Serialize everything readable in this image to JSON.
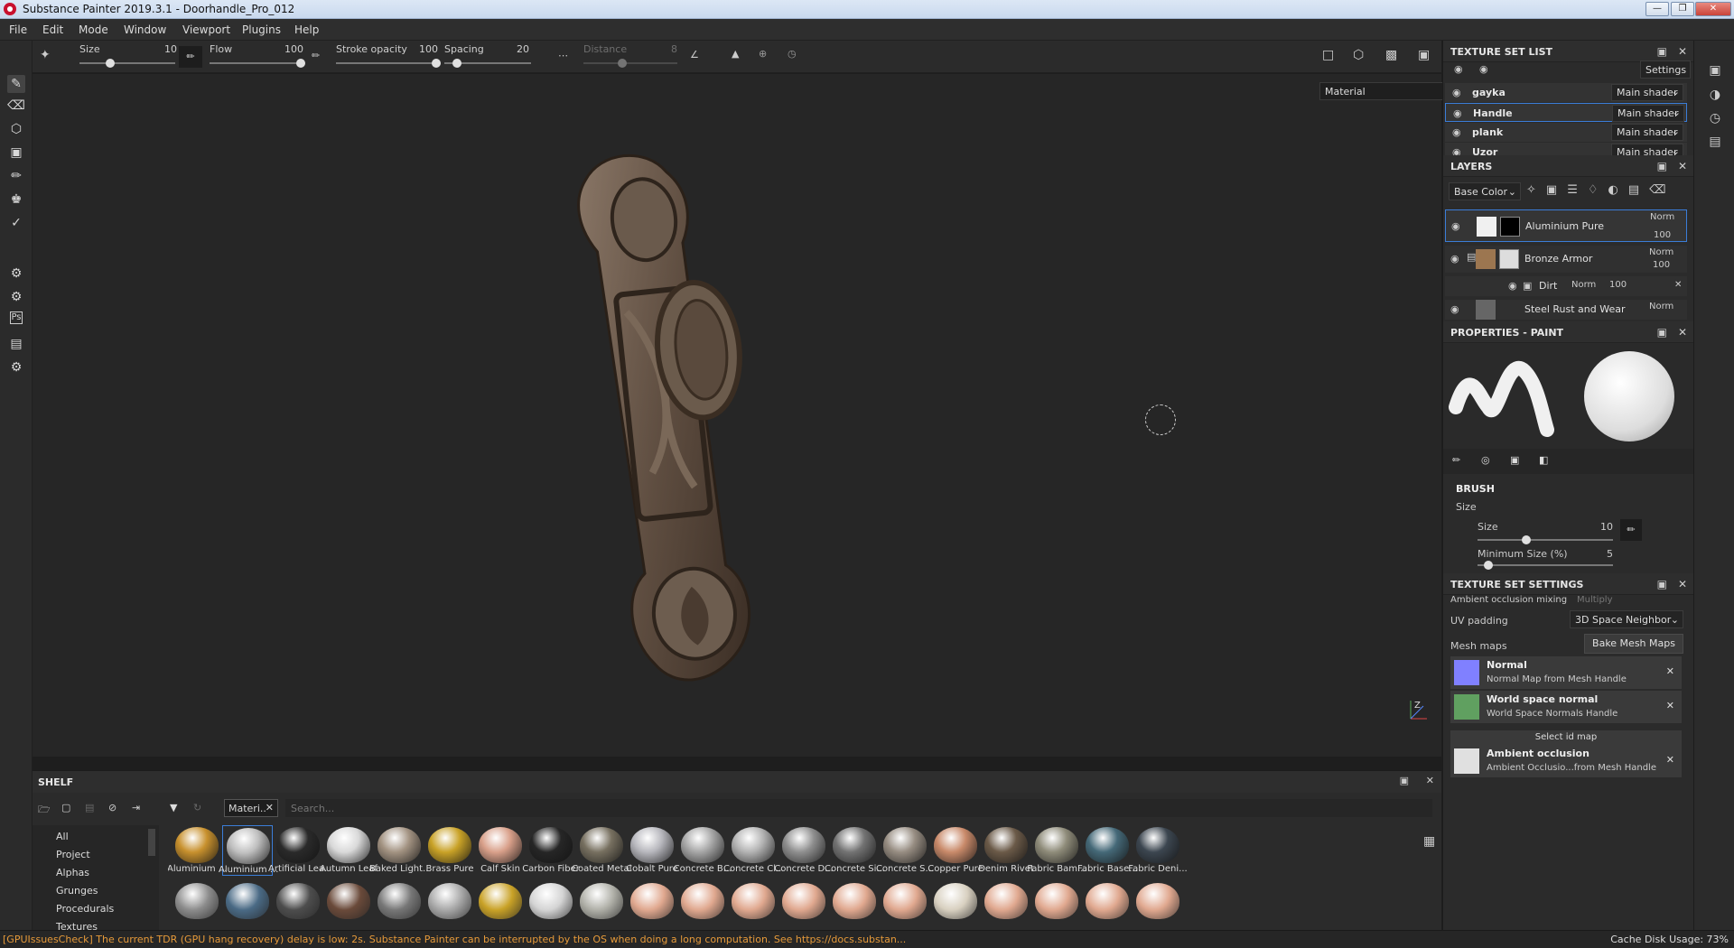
{
  "window": {
    "title": "Substance Painter 2019.3.1 - Doorhandle_Pro_012"
  },
  "menu": [
    "File",
    "Edit",
    "Mode",
    "Window",
    "Viewport",
    "Plugins",
    "Help"
  ],
  "toolbar": {
    "size_label": "Size",
    "size_value": "10",
    "size_level": 0.3,
    "flow_label": "Flow",
    "flow_value": "100",
    "flow_level": 1.0,
    "opacity_label": "Stroke opacity",
    "opacity_value": "100",
    "opacity_level": 1.0,
    "spacing_label": "Spacing",
    "spacing_value": "20",
    "spacing_level": 0.1,
    "distance_label": "Distance",
    "distance_value": "8",
    "distance_level": 0.4
  },
  "viewport": {
    "display_mode": "Material"
  },
  "texture_set_list": {
    "title": "TEXTURE SET LIST",
    "settings_label": "Settings",
    "sets": [
      {
        "name": "gayka",
        "shader": "Main shader"
      },
      {
        "name": "Handle",
        "shader": "Main shader"
      },
      {
        "name": "plank",
        "shader": "Main shader"
      },
      {
        "name": "Uzor",
        "shader": "Main shader"
      }
    ]
  },
  "layers": {
    "title": "LAYERS",
    "channel": "Base Color",
    "items": [
      {
        "name": "Aluminium Pure",
        "blend": "Norm",
        "opacity": "100"
      },
      {
        "name": "Bronze Armor",
        "blend": "Norm",
        "opacity": "100"
      },
      {
        "name": "Dirt",
        "blend": "Norm",
        "opacity": "100"
      },
      {
        "name": "Steel Rust and Wear",
        "blend": "Norm",
        "opacity": ""
      }
    ]
  },
  "properties": {
    "title": "PROPERTIES - PAINT",
    "section": "BRUSH",
    "size_heading": "Size",
    "size_label": "Size",
    "size_value": "10",
    "size_level": 0.35,
    "min_size_label": "Minimum Size (%)",
    "min_size_value": "5",
    "min_size_level": 0.05
  },
  "texture_set_settings": {
    "title": "TEXTURE SET SETTINGS",
    "ao_mixing_label": "Ambient occlusion mixing",
    "ao_mixing_value": "Multiply",
    "uv_padding_label": "UV padding",
    "uv_padding_value": "3D Space Neighbor",
    "mesh_maps_label": "Mesh maps",
    "bake_button": "Bake Mesh Maps",
    "maps": [
      {
        "name": "Normal",
        "sub": "Normal Map from Mesh Handle",
        "color": "#8080ff"
      },
      {
        "name": "World space normal",
        "sub": "World Space Normals Handle",
        "color": "#60a060"
      },
      {
        "name": "Ambient occlusion",
        "sub": "Ambient Occlusio...from Mesh Handle",
        "color": "#e0e0e0"
      }
    ],
    "select_id_label": "Select id map"
  },
  "shelf": {
    "title": "SHELF",
    "filter_tag": "Materi..",
    "search_placeholder": "Search...",
    "categories": [
      "All",
      "Project",
      "Alphas",
      "Grunges",
      "Procedurals",
      "Textures"
    ],
    "row1": [
      {
        "label": "Aluminium ...",
        "color": "#c8912e"
      },
      {
        "label": "Aluminium ...",
        "color": "#bfbfbf"
      },
      {
        "label": "Artificial Lea...",
        "color": "#2a2a2a"
      },
      {
        "label": "Autumn Leaf",
        "color": "#d9d9d9"
      },
      {
        "label": "Baked Light...",
        "color": "#a39382"
      },
      {
        "label": "Brass Pure",
        "color": "#c9a227"
      },
      {
        "label": "Calf Skin",
        "color": "#d9a08a"
      },
      {
        "label": "Carbon Fiber",
        "color": "#262626"
      },
      {
        "label": "Coated Metal",
        "color": "#777060"
      },
      {
        "label": "Cobalt Pure",
        "color": "#b7b7bd"
      },
      {
        "label": "Concrete B...",
        "color": "#a6a6a6"
      },
      {
        "label": "Concrete Cl...",
        "color": "#b3b3b3"
      },
      {
        "label": "Concrete D...",
        "color": "#8f8f8f"
      },
      {
        "label": "Concrete Si...",
        "color": "#737373"
      },
      {
        "label": "Concrete S...",
        "color": "#978d82"
      },
      {
        "label": "Copper Pure",
        "color": "#c98a6a"
      },
      {
        "label": "Denim Rivet",
        "color": "#6b5a48"
      },
      {
        "label": "Fabric Bam...",
        "color": "#8f8c7a"
      },
      {
        "label": "Fabric Base...",
        "color": "#456978"
      },
      {
        "label": "Fabric Deni...",
        "color": "#3c4650"
      }
    ],
    "row2": [
      "#8c8c8c",
      "#4a6a85",
      "#4d4d4d",
      "#6a4a3a",
      "#777777",
      "#a8a8a8",
      "#c9a227",
      "#d4d4d4",
      "#b0b0a8",
      "#e0a88f",
      "#e0a88f",
      "#e0a88f",
      "#e0a88f",
      "#e0a88f",
      "#e0a88f",
      "#d8d0c0",
      "#e0a88f",
      "#e0a88f",
      "#e0a88f",
      "#e0a88f"
    ]
  },
  "status": {
    "message": "[GPUIssuesCheck] The current TDR (GPU hang recovery) delay is low: 2s. Substance Painter can be interrupted by the OS when doing a long computation. See https://docs.substan...",
    "cache_label": "Cache Disk Usage:",
    "cache_value": "73%"
  }
}
